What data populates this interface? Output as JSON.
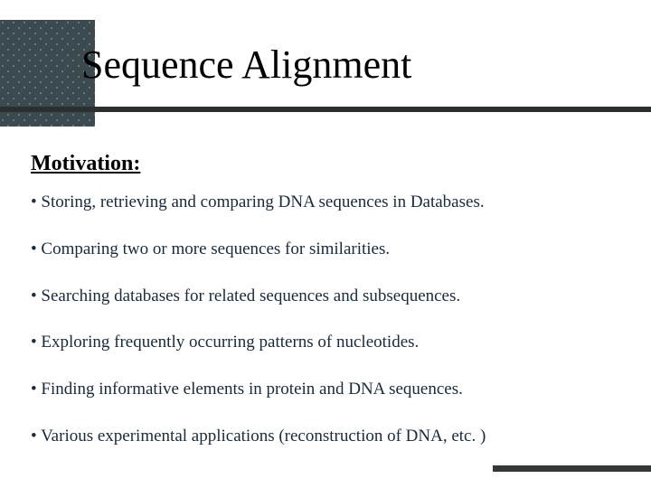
{
  "title": "Sequence Alignment",
  "subtitle": "Motivation:",
  "bullets": [
    "Storing, retrieving and comparing DNA sequences in Databases.",
    "Comparing two or more sequences for similarities.",
    "Searching databases for related sequences and subsequences.",
    "Exploring frequently occurring patterns of nucleotides.",
    "Finding informative elements in protein and DNA sequences.",
    "Various experimental applications (reconstruction of DNA, etc. )"
  ]
}
